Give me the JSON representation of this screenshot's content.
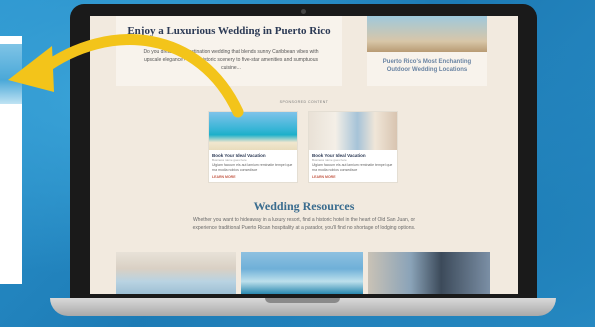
{
  "hero_card": {
    "title": "Enjoy a Luxurious Wedding in Puerto Rico",
    "description": "Do you dream of a destination wedding that blends sunny Caribbean vibes with upscale elegance? From historic scenery to five-star amenities and sumptuous cuisine..."
  },
  "side_card": {
    "title": "Puerto Rico's Most Enchanting Outdoor Wedding Locations"
  },
  "sponsored_label": "SPONSORED CONTENT",
  "ads": [
    {
      "title": "Book Your Ideal Vacation",
      "subtitle": "Business name goes here",
      "body": "Ulgiam faccum els aut lamium reminatie tempel que rna modia nobios consedisce",
      "cta": "LEARN MORE"
    },
    {
      "title": "Book Your Ideal Vacation",
      "subtitle": "Business name goes here",
      "body": "Ulgiam faccum els aut lamium reminatie tempel que rna modia nobios consedisce",
      "cta": "LEARN MORE"
    }
  ],
  "resources": {
    "title": "Wedding Resources",
    "body": "Whether you want to hideaway in a luxury resort, find a historic hotel in the heart of Old San Juan, or experience traditional Puerto Rican hospitality at a parador, you'll find no shortage of lodging options."
  },
  "colors": {
    "arrow": "#f3c41a",
    "heading": "#2c3a55",
    "resources_heading": "#3b6d8f",
    "cta": "#c45a47",
    "page_bg": "#f2eadf"
  }
}
